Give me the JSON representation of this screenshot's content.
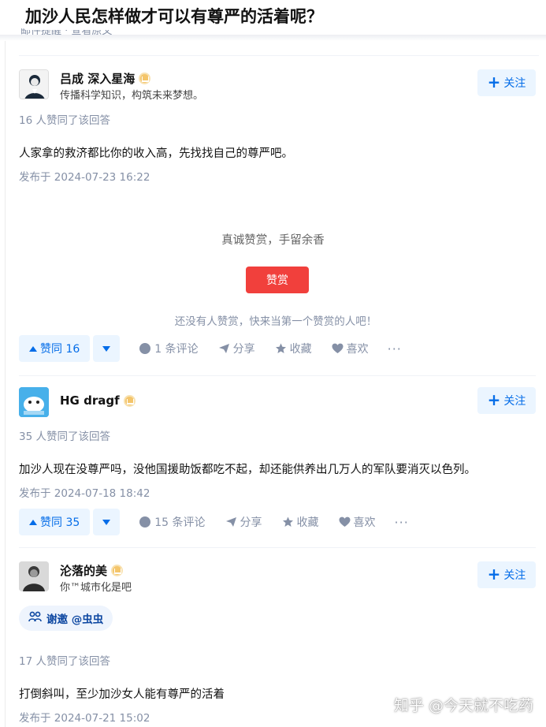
{
  "question": {
    "title": "加沙人民怎样做才可以有尊严的活着呢？",
    "behind_title_text": "邮件提醒 · 查看原文"
  },
  "answers": [
    {
      "author_name": "吕成 深入星海",
      "author_bio": "传播科学知识，构筑未来梦想。",
      "follow_label": "关注",
      "vote_text": "16 人赞同了该回答",
      "content": "人家拿的救济都比你的收入高，先找找自己的尊严吧。",
      "published": "发布于 2024-07-23 16:22",
      "reward": {
        "title": "真诚赞赏，手留余香",
        "button": "赞赏",
        "note": "还没有人赞赏，快来当第一个赞赏的人吧！"
      },
      "actions": {
        "upvote": "赞同 16",
        "comments": "1 条评论",
        "share": "分享",
        "collect": "收藏",
        "like": "喜欢",
        "more": "···"
      }
    },
    {
      "author_name": "HG dragf",
      "author_bio": "",
      "follow_label": "关注",
      "vote_text": "35 人赞同了该回答",
      "content": "加沙人现在没尊严吗，没他国援助饭都吃不起，却还能供养出几万人的军队要消灭以色列。",
      "published": "发布于 2024-07-18 18:42",
      "actions": {
        "upvote": "赞同 35",
        "comments": "15 条评论",
        "share": "分享",
        "collect": "收藏",
        "like": "喜欢",
        "more": "···"
      }
    },
    {
      "author_name": "沦落的美",
      "author_bio": "你™城市化是吧",
      "follow_label": "关注",
      "invite": "谢邀 @虫虫",
      "vote_text": "17 人赞同了该回答",
      "content": "打倒斜叫，至少加沙女人能有尊严的活着",
      "published": "发布于 2024-07-21 15:02"
    }
  ],
  "watermark": "知乎 @今天就不吃药",
  "colors": {
    "brand_blue": "#056de8",
    "reward_red": "#f1403c",
    "meta_gray": "#8590a6"
  }
}
